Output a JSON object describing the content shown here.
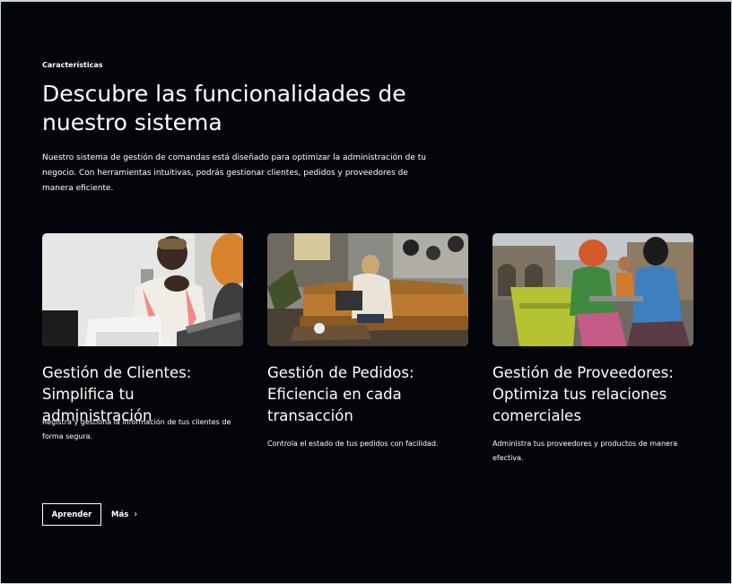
{
  "section": {
    "eyebrow": "Características",
    "title": "Descubre las funcionalidades de nuestro sistema",
    "description": "Nuestro sistema de gestión de comandas está diseñado para optimizar la administración de tu negocio. Con herramientas intuitivas, podrás gestionar clientes, pedidos y proveedores de manera eficiente."
  },
  "features": [
    {
      "title": "Gestión de Clientes: Simplifica tu administración",
      "text": "Registra y gestiona la información de tus clientes de forma segura."
    },
    {
      "title": "Gestión de Pedidos: Eficiencia en cada transacción",
      "text": "Controla el estado de tus pedidos con facilidad."
    },
    {
      "title": "Gestión de Proveedores: Optimiza tus relaciones comerciales",
      "text": "Administra tus proveedores y productos de manera efectiva."
    }
  ],
  "actions": {
    "primary_label": "Aprender",
    "secondary_label": "Más",
    "secondary_icon": "chevron-right-icon"
  },
  "colors": {
    "background": "#04050a",
    "text": "#ffffff"
  }
}
